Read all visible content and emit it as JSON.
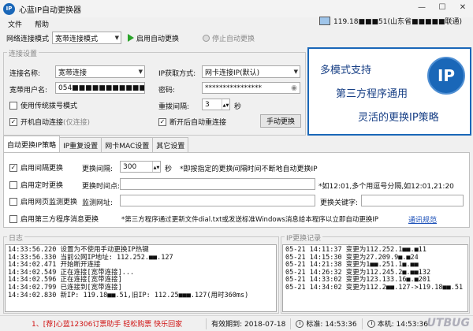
{
  "window": {
    "title": "心蓝IP自动更换器",
    "minimize": "—",
    "maximize": "☐",
    "close": "✕"
  },
  "menu": {
    "file": "文件",
    "help": "帮助"
  },
  "ip_status": "119.18■■■51(山东省■■■■■联通)",
  "toolbar": {
    "mode_label": "网络连接模式",
    "mode_value": "宽带连接模式",
    "start_label": "启用自动更换",
    "stop_label": "停止自动更换"
  },
  "connection_settings": {
    "title": "连接设置",
    "connection_name_label": "连接名称:",
    "connection_name_value": "宽带连接",
    "ip_method_label": "IP获取方式:",
    "ip_method_value": "网卡连接IP(默认)",
    "username_label": "宽带用户名:",
    "username_value": "054■■■■■■■■■■■",
    "password_label": "密码:",
    "password_value": "****************",
    "legacy_dial_label": "使用传统拨号模式",
    "legacy_dial_checked": false,
    "retry_label": "重拨间隔:",
    "retry_value": "3",
    "retry_unit": "秒",
    "auto_connect_label": "开机自动连接",
    "auto_connect_note": "(仅连接)",
    "auto_connect_checked": true,
    "reconnect_label": "断开后自动重连接",
    "reconnect_checked": true,
    "manual_button": "手动更换"
  },
  "promo": {
    "line1": "多模式支持",
    "line2": "第三方程序通用",
    "line3": "灵活的更换IP策略",
    "logo": "IP"
  },
  "tabs": [
    {
      "label": "自动更换IP策略",
      "active": true
    },
    {
      "label": "IP重复设置",
      "active": false
    },
    {
      "label": "网卡MAC设置",
      "active": false
    },
    {
      "label": "其它设置",
      "active": false
    }
  ],
  "strategy": {
    "interval_enable_label": "启用间隔更换",
    "interval_enable_checked": true,
    "interval_label": "更换间隔:",
    "interval_value": "300",
    "interval_unit": "秒",
    "interval_note": "*即按指定的更换间隔时间不断地自动更换IP",
    "timed_enable_label": "启用定时更换",
    "timed_enable_checked": false,
    "timed_label": "更换时间点:",
    "timed_value": "",
    "timed_note": "*如12:01,多个用逗号分隔,如12:01,21:20",
    "web_monitor_label": "启用网页监测更换",
    "web_monitor_checked": false,
    "web_monitor_url_label": "监测网址:",
    "web_monitor_url_value": "",
    "keyword_label": "更换关键字:",
    "keyword_value": "",
    "third_party_label": "启用第三方程序消息更换",
    "third_party_checked": false,
    "third_party_note": "*第三方程序通过更新文件dial.txt或发送标准Windows消息给本程序以立即自动更换IP",
    "third_party_link": "通讯规范"
  },
  "log": {
    "title": "日志",
    "lines": [
      "14:33:56.220  设置为不使用手动更换IP热键",
      "14:33:56.330  当前公网IP地址: 112.252.■■.127",
      "14:34:02.471  开始断开连接",
      "14:34:02.549  正在连接[宽带连接]...",
      "14:34:02.596  正在连接[宽带连接]",
      "14:34:02.799  已连接到[宽带连接]",
      "14:34:02.830  新IP: 119.18■■.51,旧IP: 112.25■■■.127(用时360ms)"
    ]
  },
  "ip_history": {
    "title": "IP更换记录",
    "lines": [
      "05-21  14:11:37  变更为112.252.1■■.■11",
      "05-21  14:15:30  变更为27.209.9■.■24",
      "05-21  14:21:38  变更为1■■.251.1■.■■",
      "05-21  14:26:32  变更为112.245.2■.■■132",
      "05-21  14:33:02  变更为123.133.16■.■201",
      "05-21  14:34:02  变更为112.2■■.127->119.18■■.51"
    ]
  },
  "statusbar": {
    "ad": "1、[荐]心蓝12306订票助手 轻松购票 快乐回家",
    "valid_until": "有效期到: 2018-07-18",
    "standard_time": "标准: 14:53:36",
    "local_time": "本机: 14:53:36"
  },
  "watermark": "UTBUG"
}
